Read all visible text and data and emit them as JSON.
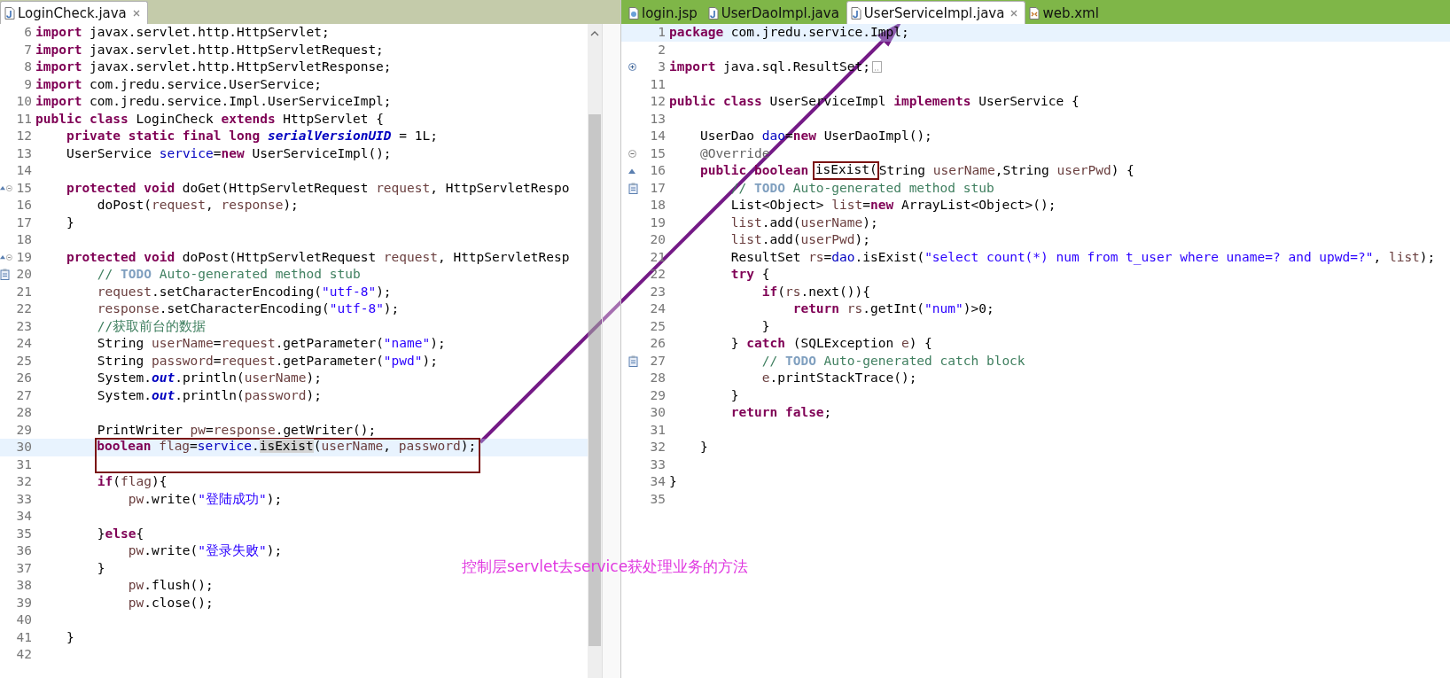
{
  "editors": [
    {
      "tabs": [
        {
          "label": "LoginCheck.java",
          "kind": "java",
          "selected": true
        }
      ],
      "lines": [
        {
          "n": "6",
          "current": false,
          "segs": [
            {
              "kind": "keyword",
              "text": "import"
            },
            {
              "kind": "plain",
              "text": " javax.servlet.http.HttpServlet;"
            }
          ]
        },
        {
          "n": "7",
          "current": false,
          "segs": [
            {
              "kind": "keyword",
              "text": "import"
            },
            {
              "kind": "plain",
              "text": " javax.servlet.http.HttpServletRequest;"
            }
          ]
        },
        {
          "n": "8",
          "current": false,
          "segs": [
            {
              "kind": "keyword",
              "text": "import"
            },
            {
              "kind": "plain",
              "text": " javax.servlet.http.HttpServletResponse;"
            }
          ]
        },
        {
          "n": "9",
          "current": false,
          "segs": [
            {
              "kind": "keyword",
              "text": "import"
            },
            {
              "kind": "plain",
              "text": " com.jredu.service.UserService;"
            }
          ]
        },
        {
          "n": "10",
          "current": false,
          "segs": [
            {
              "kind": "keyword",
              "text": "import"
            },
            {
              "kind": "plain",
              "text": " com.jredu.service.Impl.UserServiceImpl;"
            }
          ]
        },
        {
          "n": "11",
          "current": false,
          "segs": [
            {
              "kind": "keyword",
              "text": "public class"
            },
            {
              "kind": "plain",
              "text": " LoginCheck "
            },
            {
              "kind": "keyword",
              "text": "extends"
            },
            {
              "kind": "plain",
              "text": " HttpServlet {"
            }
          ]
        },
        {
          "n": "12",
          "current": false,
          "segs": [
            {
              "kind": "keyword",
              "text": "    private static final long "
            },
            {
              "kind": "static",
              "text": "serialVersionUID"
            },
            {
              "kind": "plain",
              "text": " = 1L;"
            }
          ]
        },
        {
          "n": "13",
          "current": false,
          "segs": [
            {
              "kind": "plain",
              "text": "    UserService "
            },
            {
              "kind": "field",
              "text": "service"
            },
            {
              "kind": "plain",
              "text": "="
            },
            {
              "kind": "keyword",
              "text": "new"
            },
            {
              "kind": "plain",
              "text": " UserServiceImpl();"
            }
          ]
        },
        {
          "n": "14",
          "current": false
        },
        {
          "n": "15",
          "current": false,
          "markers": [
            {
              "kind": "override"
            },
            {
              "kind": "fold-open"
            }
          ],
          "segs": [
            {
              "kind": "keyword",
              "text": "    protected void"
            },
            {
              "kind": "plain",
              "text": " doGet(HttpServletRequest "
            },
            {
              "kind": "local",
              "text": "request"
            },
            {
              "kind": "plain",
              "text": ", HttpServletRespo"
            }
          ]
        },
        {
          "n": "16",
          "current": false,
          "segs": [
            {
              "kind": "plain",
              "text": "        doPost("
            },
            {
              "kind": "local",
              "text": "request"
            },
            {
              "kind": "plain",
              "text": ", "
            },
            {
              "kind": "local",
              "text": "response"
            },
            {
              "kind": "plain",
              "text": ");"
            }
          ]
        },
        {
          "n": "17",
          "current": false,
          "segs": [
            {
              "kind": "plain",
              "text": "    }"
            }
          ]
        },
        {
          "n": "18",
          "current": false
        },
        {
          "n": "19",
          "current": false,
          "markers": [
            {
              "kind": "override"
            },
            {
              "kind": "fold-open"
            }
          ],
          "segs": [
            {
              "kind": "keyword",
              "text": "    protected void"
            },
            {
              "kind": "plain",
              "text": " doPost(HttpServletRequest "
            },
            {
              "kind": "local",
              "text": "request"
            },
            {
              "kind": "plain",
              "text": ", HttpServletResp"
            }
          ]
        },
        {
          "n": "20",
          "current": false,
          "markers": [
            {
              "kind": "task"
            }
          ],
          "segs": [
            {
              "kind": "comment",
              "text": "        // "
            },
            {
              "kind": "todo",
              "text": "TODO"
            },
            {
              "kind": "comment",
              "text": " Auto-generated method stub"
            }
          ]
        },
        {
          "n": "21",
          "current": false,
          "segs": [
            {
              "kind": "local",
              "text": "        request"
            },
            {
              "kind": "plain",
              "text": ".setCharacterEncoding("
            },
            {
              "kind": "string",
              "text": "\"utf-8\""
            },
            {
              "kind": "plain",
              "text": ");"
            }
          ]
        },
        {
          "n": "22",
          "current": false,
          "segs": [
            {
              "kind": "local",
              "text": "        response"
            },
            {
              "kind": "plain",
              "text": ".setCharacterEncoding("
            },
            {
              "kind": "string",
              "text": "\"utf-8\""
            },
            {
              "kind": "plain",
              "text": ");"
            }
          ]
        },
        {
          "n": "23",
          "current": false,
          "segs": [
            {
              "kind": "comment",
              "text": "        //获取前台的数据"
            }
          ]
        },
        {
          "n": "24",
          "current": false,
          "segs": [
            {
              "kind": "plain",
              "text": "        String "
            },
            {
              "kind": "local",
              "text": "userName"
            },
            {
              "kind": "plain",
              "text": "="
            },
            {
              "kind": "local",
              "text": "request"
            },
            {
              "kind": "plain",
              "text": ".getParameter("
            },
            {
              "kind": "string",
              "text": "\"name\""
            },
            {
              "kind": "plain",
              "text": ");"
            }
          ]
        },
        {
          "n": "25",
          "current": false,
          "segs": [
            {
              "kind": "plain",
              "text": "        String "
            },
            {
              "kind": "local",
              "text": "password"
            },
            {
              "kind": "plain",
              "text": "="
            },
            {
              "kind": "local",
              "text": "request"
            },
            {
              "kind": "plain",
              "text": ".getParameter("
            },
            {
              "kind": "string",
              "text": "\"pwd\""
            },
            {
              "kind": "plain",
              "text": ");"
            }
          ]
        },
        {
          "n": "26",
          "current": false,
          "segs": [
            {
              "kind": "plain",
              "text": "        System."
            },
            {
              "kind": "static",
              "text": "out"
            },
            {
              "kind": "plain",
              "text": ".println("
            },
            {
              "kind": "local",
              "text": "userName"
            },
            {
              "kind": "plain",
              "text": ");"
            }
          ]
        },
        {
          "n": "27",
          "current": false,
          "segs": [
            {
              "kind": "plain",
              "text": "        System."
            },
            {
              "kind": "static",
              "text": "out"
            },
            {
              "kind": "plain",
              "text": ".println("
            },
            {
              "kind": "local",
              "text": "password"
            },
            {
              "kind": "plain",
              "text": ");"
            }
          ]
        },
        {
          "n": "28",
          "current": false
        },
        {
          "n": "29",
          "current": false,
          "segs": [
            {
              "kind": "plain",
              "text": "        PrintWriter "
            },
            {
              "kind": "local",
              "text": "pw"
            },
            {
              "kind": "plain",
              "text": "="
            },
            {
              "kind": "local",
              "text": "response"
            },
            {
              "kind": "plain",
              "text": ".getWriter();"
            }
          ]
        },
        {
          "n": "30",
          "current": true,
          "box": {
            "kind": "tall",
            "segs": [
              {
                "kind": "keyword",
                "text": "boolean"
              },
              {
                "kind": "local",
                "text": " flag"
              },
              {
                "kind": "plain",
                "text": "="
              },
              {
                "kind": "field",
                "text": "service"
              },
              {
                "kind": "plain",
                "text": "."
              },
              {
                "kind": "occurrence",
                "text": "isExist"
              },
              {
                "kind": "plain",
                "text": "("
              },
              {
                "kind": "local",
                "text": "userName"
              },
              {
                "kind": "plain",
                "text": ", "
              },
              {
                "kind": "local",
                "text": "password"
              },
              {
                "kind": "plain",
                "text": ");"
              }
            ]
          }
        },
        {
          "n": "31",
          "current": false
        },
        {
          "n": "32",
          "current": false,
          "segs": [
            {
              "kind": "keyword",
              "text": "        if"
            },
            {
              "kind": "plain",
              "text": "("
            },
            {
              "kind": "local",
              "text": "flag"
            },
            {
              "kind": "plain",
              "text": "){"
            }
          ]
        },
        {
          "n": "33",
          "current": false,
          "segs": [
            {
              "kind": "local",
              "text": "            pw"
            },
            {
              "kind": "plain",
              "text": ".write("
            },
            {
              "kind": "string",
              "text": "\"登陆成功\""
            },
            {
              "kind": "plain",
              "text": ");"
            }
          ]
        },
        {
          "n": "34",
          "current": false
        },
        {
          "n": "35",
          "current": false,
          "segs": [
            {
              "kind": "plain",
              "text": "        }"
            },
            {
              "kind": "keyword",
              "text": "else"
            },
            {
              "kind": "plain",
              "text": "{"
            }
          ]
        },
        {
          "n": "36",
          "current": false,
          "segs": [
            {
              "kind": "local",
              "text": "            pw"
            },
            {
              "kind": "plain",
              "text": ".write("
            },
            {
              "kind": "string",
              "text": "\"登录失败\""
            },
            {
              "kind": "plain",
              "text": ");"
            }
          ]
        },
        {
          "n": "37",
          "current": false,
          "segs": [
            {
              "kind": "plain",
              "text": "        }"
            }
          ]
        },
        {
          "n": "38",
          "current": false,
          "segs": [
            {
              "kind": "local",
              "text": "            pw"
            },
            {
              "kind": "plain",
              "text": ".flush();"
            }
          ]
        },
        {
          "n": "39",
          "current": false,
          "segs": [
            {
              "kind": "local",
              "text": "            pw"
            },
            {
              "kind": "plain",
              "text": ".close();"
            }
          ]
        },
        {
          "n": "40",
          "current": false
        },
        {
          "n": "41",
          "current": false,
          "segs": [
            {
              "kind": "plain",
              "text": "    }"
            }
          ]
        },
        {
          "n": "42",
          "current": false
        }
      ]
    },
    {
      "tabs": [
        {
          "label": "login.jsp",
          "kind": "jsp",
          "selected": false
        },
        {
          "label": "UserDaoImpl.java",
          "kind": "java",
          "selected": false
        },
        {
          "label": "UserServiceImpl.java",
          "kind": "java",
          "selected": true
        },
        {
          "label": "web.xml",
          "kind": "xml",
          "selected": false
        }
      ],
      "lines": [
        {
          "n": "1",
          "current": true,
          "segs": [
            {
              "kind": "keyword",
              "text": "package"
            },
            {
              "kind": "plain",
              "text": " com.jredu.service.Impl;"
            }
          ]
        },
        {
          "n": "2",
          "current": false
        },
        {
          "n": "3",
          "current": false,
          "markers": [
            {
              "kind": "fold-closed"
            }
          ],
          "end_marker": {
            "kind": "folded"
          },
          "segs": [
            {
              "kind": "keyword",
              "text": "import"
            },
            {
              "kind": "plain",
              "text": " java.sql.ResultSet;"
            }
          ]
        },
        {
          "n": "11",
          "current": false
        },
        {
          "n": "12",
          "current": false,
          "segs": [
            {
              "kind": "keyword",
              "text": "public class"
            },
            {
              "kind": "plain",
              "text": " UserServiceImpl "
            },
            {
              "kind": "keyword",
              "text": "implements"
            },
            {
              "kind": "plain",
              "text": " UserService {"
            }
          ]
        },
        {
          "n": "13",
          "current": false
        },
        {
          "n": "14",
          "current": false,
          "segs": [
            {
              "kind": "plain",
              "text": "    UserDao "
            },
            {
              "kind": "field",
              "text": "dao"
            },
            {
              "kind": "plain",
              "text": "="
            },
            {
              "kind": "keyword",
              "text": "new"
            },
            {
              "kind": "plain",
              "text": " UserDaoImpl();"
            }
          ]
        },
        {
          "n": "15",
          "current": false,
          "markers": [
            {
              "kind": "fold-open"
            }
          ],
          "segs": [
            {
              "kind": "annotation",
              "text": "    @Override"
            }
          ]
        },
        {
          "n": "16",
          "current": false,
          "markers": [
            {
              "kind": "override"
            }
          ],
          "segs": [
            {
              "kind": "keyword",
              "text": "    public boolean "
            }
          ],
          "box": {
            "kind": "tight",
            "segs": [
              {
                "kind": "plain",
                "text": "isExist("
              }
            ]
          },
          "tail": [
            {
              "kind": "plain",
              "text": "String "
            },
            {
              "kind": "local",
              "text": "userName"
            },
            {
              "kind": "plain",
              "text": ",String "
            },
            {
              "kind": "local",
              "text": "userPwd"
            },
            {
              "kind": "plain",
              "text": ") {"
            }
          ]
        },
        {
          "n": "17",
          "current": false,
          "markers": [
            {
              "kind": "task"
            }
          ],
          "segs": [
            {
              "kind": "comment",
              "text": "        // "
            },
            {
              "kind": "todo",
              "text": "TODO"
            },
            {
              "kind": "comment",
              "text": " Auto-generated method stub"
            }
          ]
        },
        {
          "n": "18",
          "current": false,
          "segs": [
            {
              "kind": "plain",
              "text": "        List<Object> "
            },
            {
              "kind": "local",
              "text": "list"
            },
            {
              "kind": "plain",
              "text": "="
            },
            {
              "kind": "keyword",
              "text": "new"
            },
            {
              "kind": "plain",
              "text": " ArrayList<Object>();"
            }
          ]
        },
        {
          "n": "19",
          "current": false,
          "segs": [
            {
              "kind": "local",
              "text": "        list"
            },
            {
              "kind": "plain",
              "text": ".add("
            },
            {
              "kind": "local",
              "text": "userName"
            },
            {
              "kind": "plain",
              "text": ");"
            }
          ]
        },
        {
          "n": "20",
          "current": false,
          "segs": [
            {
              "kind": "local",
              "text": "        list"
            },
            {
              "kind": "plain",
              "text": ".add("
            },
            {
              "kind": "local",
              "text": "userPwd"
            },
            {
              "kind": "plain",
              "text": ");"
            }
          ]
        },
        {
          "n": "21",
          "current": false,
          "segs": [
            {
              "kind": "plain",
              "text": "        ResultSet "
            },
            {
              "kind": "local",
              "text": "rs"
            },
            {
              "kind": "plain",
              "text": "="
            },
            {
              "kind": "field",
              "text": "dao"
            },
            {
              "kind": "plain",
              "text": ".isExist("
            },
            {
              "kind": "string",
              "text": "\"select count(*) num from t_user where uname=? and upwd=?\""
            },
            {
              "kind": "plain",
              "text": ", "
            },
            {
              "kind": "local",
              "text": "list"
            },
            {
              "kind": "plain",
              "text": ");"
            }
          ]
        },
        {
          "n": "22",
          "current": false,
          "segs": [
            {
              "kind": "keyword",
              "text": "        try"
            },
            {
              "kind": "plain",
              "text": " {"
            }
          ]
        },
        {
          "n": "23",
          "current": false,
          "segs": [
            {
              "kind": "keyword",
              "text": "            if"
            },
            {
              "kind": "plain",
              "text": "("
            },
            {
              "kind": "local",
              "text": "rs"
            },
            {
              "kind": "plain",
              "text": ".next()){"
            }
          ]
        },
        {
          "n": "24",
          "current": false,
          "segs": [
            {
              "kind": "keyword",
              "text": "                return"
            },
            {
              "kind": "local",
              "text": " rs"
            },
            {
              "kind": "plain",
              "text": ".getInt("
            },
            {
              "kind": "string",
              "text": "\"num\""
            },
            {
              "kind": "plain",
              "text": ")>0;"
            }
          ]
        },
        {
          "n": "25",
          "current": false,
          "segs": [
            {
              "kind": "plain",
              "text": "            }"
            }
          ]
        },
        {
          "n": "26",
          "current": false,
          "segs": [
            {
              "kind": "plain",
              "text": "        } "
            },
            {
              "kind": "keyword",
              "text": "catch"
            },
            {
              "kind": "plain",
              "text": " (SQLException "
            },
            {
              "kind": "local",
              "text": "e"
            },
            {
              "kind": "plain",
              "text": ") {"
            }
          ]
        },
        {
          "n": "27",
          "current": false,
          "markers": [
            {
              "kind": "task"
            }
          ],
          "segs": [
            {
              "kind": "comment",
              "text": "            // "
            },
            {
              "kind": "todo",
              "text": "TODO"
            },
            {
              "kind": "comment",
              "text": " Auto-generated catch block"
            }
          ]
        },
        {
          "n": "28",
          "current": false,
          "segs": [
            {
              "kind": "local",
              "text": "            e"
            },
            {
              "kind": "plain",
              "text": ".printStackTrace();"
            }
          ]
        },
        {
          "n": "29",
          "current": false,
          "segs": [
            {
              "kind": "plain",
              "text": "        }"
            }
          ]
        },
        {
          "n": "30",
          "current": false,
          "segs": [
            {
              "kind": "keyword",
              "text": "        return false"
            },
            {
              "kind": "plain",
              "text": ";"
            }
          ]
        },
        {
          "n": "31",
          "current": false
        },
        {
          "n": "32",
          "current": false,
          "segs": [
            {
              "kind": "plain",
              "text": "    }"
            }
          ]
        },
        {
          "n": "33",
          "current": false
        },
        {
          "n": "34",
          "current": false,
          "segs": [
            {
              "kind": "plain",
              "text": "}"
            }
          ]
        },
        {
          "n": "35",
          "current": false
        }
      ]
    }
  ],
  "caption": "控制层servlet去service获处理业务的方法"
}
